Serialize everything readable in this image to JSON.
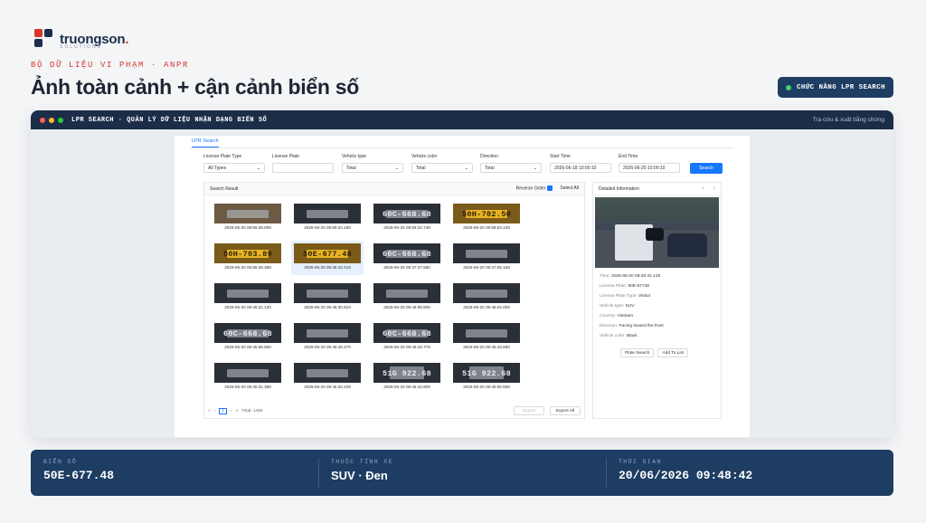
{
  "brand": {
    "name_main": "truongson",
    "name_dot": ".",
    "sub": "SOLUTIONS"
  },
  "eyebrow": "BỘ DỮ LIỆU VI PHẠM · ANPR",
  "headline": "Ảnh toàn cảnh + cận cảnh biển số",
  "feature_chip": {
    "label": "CHỨC NĂNG LPR SEARCH",
    "dot_color": "#3ecf6b"
  },
  "window": {
    "title": "LPR SEARCH · QUẢN LÝ DỮ LIỆU NHẬN DẠNG BIỂN SỐ",
    "right_text": "Tra cứu & xuất bằng chứng"
  },
  "app": {
    "tab": "LPR Search",
    "filters": {
      "plate_type": {
        "label": "License Plate Type",
        "value": "All Types"
      },
      "license_plate": {
        "label": "License Plate",
        "value": ""
      },
      "vehicle_type": {
        "label": "Vehicle type",
        "value": "Total"
      },
      "vehicle_color": {
        "label": "Vehicle color",
        "value": "Total"
      },
      "direction": {
        "label": "Direction",
        "value": "Total"
      },
      "start_time": {
        "label": "Start Time",
        "value": "2026-06-18 10:00:10"
      },
      "end_time": {
        "label": "End Time",
        "value": "2026-06-20 10:00:10"
      },
      "search_button": "Search"
    },
    "result": {
      "title": "Search Result",
      "reverse_order": "Reverse Order",
      "select_all": "Select All",
      "items": [
        {
          "time": "2026-06-20 09:59:26.599",
          "plate": "",
          "style": "warm"
        },
        {
          "time": "2026-06-20 09:59:24.189",
          "plate": "",
          "style": "dark"
        },
        {
          "time": "2026-06-20 09:59:22.748",
          "plate": "60C-668.68",
          "style": "dark"
        },
        {
          "time": "2026-06-20 09:58:53.139",
          "plate": "50H-702.50",
          "style": "yellow"
        },
        {
          "time": "2026-06-20 09:58:39.389",
          "plate": "50H-703.89",
          "style": "yellow"
        },
        {
          "time": "2026-06-20 09:48:42.419",
          "plate": "50E-677.48",
          "style": "yellow"
        },
        {
          "time": "2026-06-20 09:47:47.580",
          "plate": "60C-668.68",
          "style": "dark"
        },
        {
          "time": "2026-06-20 09:47:06.169",
          "plate": "",
          "style": "dark"
        },
        {
          "time": "2026-06-20 09:46:31.130",
          "plate": "",
          "style": "dark"
        },
        {
          "time": "2026-06-20 09:46:30.810",
          "plate": "",
          "style": "dark"
        },
        {
          "time": "2026-06-20 09:46:08.509",
          "plate": "",
          "style": "dark"
        },
        {
          "time": "2026-06-20 09:46:04.009",
          "plate": "",
          "style": "dark"
        },
        {
          "time": "2026-06-20 09:45:58.660",
          "plate": "60C-668.68",
          "style": "dark"
        },
        {
          "time": "2026-06-20 09:45:45.470",
          "plate": "",
          "style": "dark"
        },
        {
          "time": "2026-06-20 09:45:43.778",
          "plate": "60C-668.68",
          "style": "dark"
        },
        {
          "time": "2026-06-20 09:45:43.690",
          "plate": "",
          "style": "dark"
        },
        {
          "time": "2026-06-20 09:45:31.389",
          "plate": "",
          "style": "dark"
        },
        {
          "time": "2026-06-20 09:45:20.109",
          "plate": "",
          "style": "dark"
        },
        {
          "time": "2026-06-20 09:45:10.909",
          "plate": "51G 922.68",
          "style": "white"
        },
        {
          "time": "2026-06-20 09:45:00.659",
          "plate": "51G 922.68",
          "style": "white"
        }
      ],
      "selected_index": 5,
      "pagination": {
        "prev_first": "«",
        "prev": "‹",
        "page": "1",
        "next": "›",
        "next_last": "»",
        "total": "Total: 1455"
      },
      "export": "Export",
      "export_all": "Export All"
    },
    "detail": {
      "title": "Detailed Information",
      "prev": "‹",
      "next": "›",
      "fields": [
        {
          "label": "Time:",
          "value": "2026-06-20 09:48:42.419"
        },
        {
          "label": "License Plate:",
          "value": "50E-67748"
        },
        {
          "label": "License Plate Type:",
          "value": "Visitor"
        },
        {
          "label": "Vehicle type:",
          "value": "SUV"
        },
        {
          "label": "Country:",
          "value": "Vietnam"
        },
        {
          "label": "Direction:",
          "value": "Facing toward the front"
        },
        {
          "label": "Vehicle color:",
          "value": "Black"
        }
      ],
      "plate_search": "Plate Search",
      "add_to_list": "Add To List"
    }
  },
  "stats": [
    {
      "label": "BIỂN SỐ",
      "value": "50E-677.48"
    },
    {
      "label": "THUỘC TÍNH XE",
      "value": "SUV · Đen"
    },
    {
      "label": "THỜI GIAN",
      "value": "20/06/2026 09:48:42"
    }
  ]
}
